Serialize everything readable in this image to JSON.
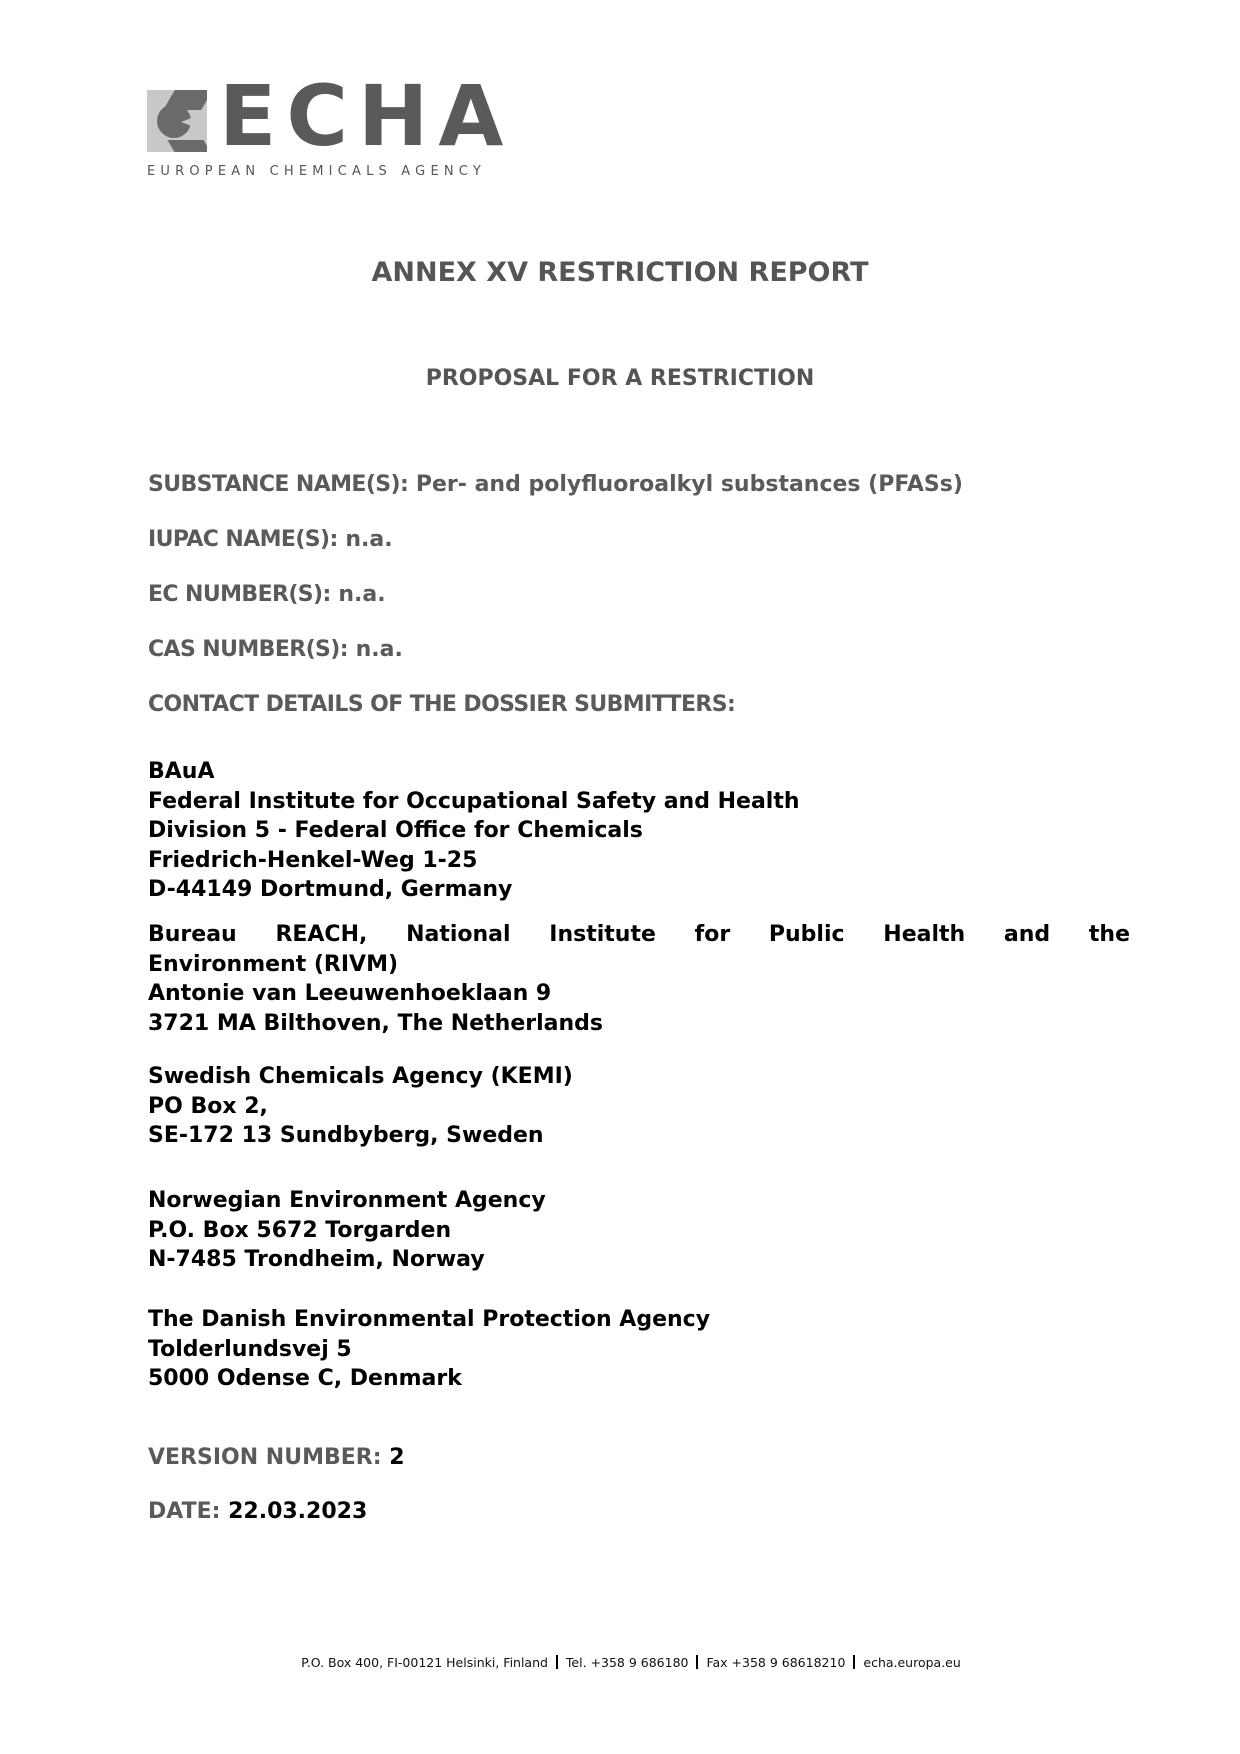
{
  "logo": {
    "wordmark": "ECHA",
    "tagline": "EUROPEAN CHEMICALS AGENCY",
    "icon": "echa-logo-mark-icon"
  },
  "title": "ANNEX XV RESTRICTION REPORT",
  "subtitle": "PROPOSAL FOR A RESTRICTION",
  "fields": [
    {
      "label": "SUBSTANCE NAME(S):",
      "value": "Per- and polyfluoroalkyl substances (PFASs)"
    },
    {
      "label": "IUPAC NAME(S):",
      "value": "n.a."
    },
    {
      "label": "EC NUMBER(S):",
      "value": "n.a."
    },
    {
      "label": "CAS NUMBER(S):",
      "value": "n.a."
    }
  ],
  "contact_heading": "CONTACT DETAILS OF THE DOSSIER SUBMITTERS:",
  "submitters": [
    {
      "lines": [
        "BAuA",
        "Federal Institute for Occupational Safety and Health",
        "Division 5 - Federal Office for Chemicals",
        "Friedrich-Henkel-Weg 1-25",
        "D-44149 Dortmund, Germany"
      ]
    },
    {
      "lines": [
        "Bureau REACH, National Institute for Public Health and the",
        "Environment (RIVM)",
        "Antonie van Leeuwenhoeklaan 9",
        "3721 MA Bilthoven, The Netherlands"
      ]
    },
    {
      "lines": [
        "Swedish Chemicals Agency (KEMI)",
        "PO Box 2,",
        "SE-172 13 Sundbyberg, Sweden"
      ]
    },
    {
      "lines": [
        "Norwegian Environment Agency",
        "P.O. Box 5672 Torgarden",
        "N-7485 Trondheim, Norway"
      ]
    },
    {
      "lines": [
        "The Danish Environmental Protection Agency",
        "Tolderlundsvej 5",
        "5000 Odense C, Denmark"
      ]
    }
  ],
  "version": {
    "label": "VERSION NUMBER:",
    "value": "2"
  },
  "date": {
    "label": "DATE:",
    "value": "22.03.2023"
  },
  "footer": {
    "address": "P.O. Box 400, FI-00121 Helsinki, Finland",
    "tel": "Tel. +358 9 686180",
    "fax": "Fax +358 9 68618210",
    "website": "echa.europa.eu"
  }
}
